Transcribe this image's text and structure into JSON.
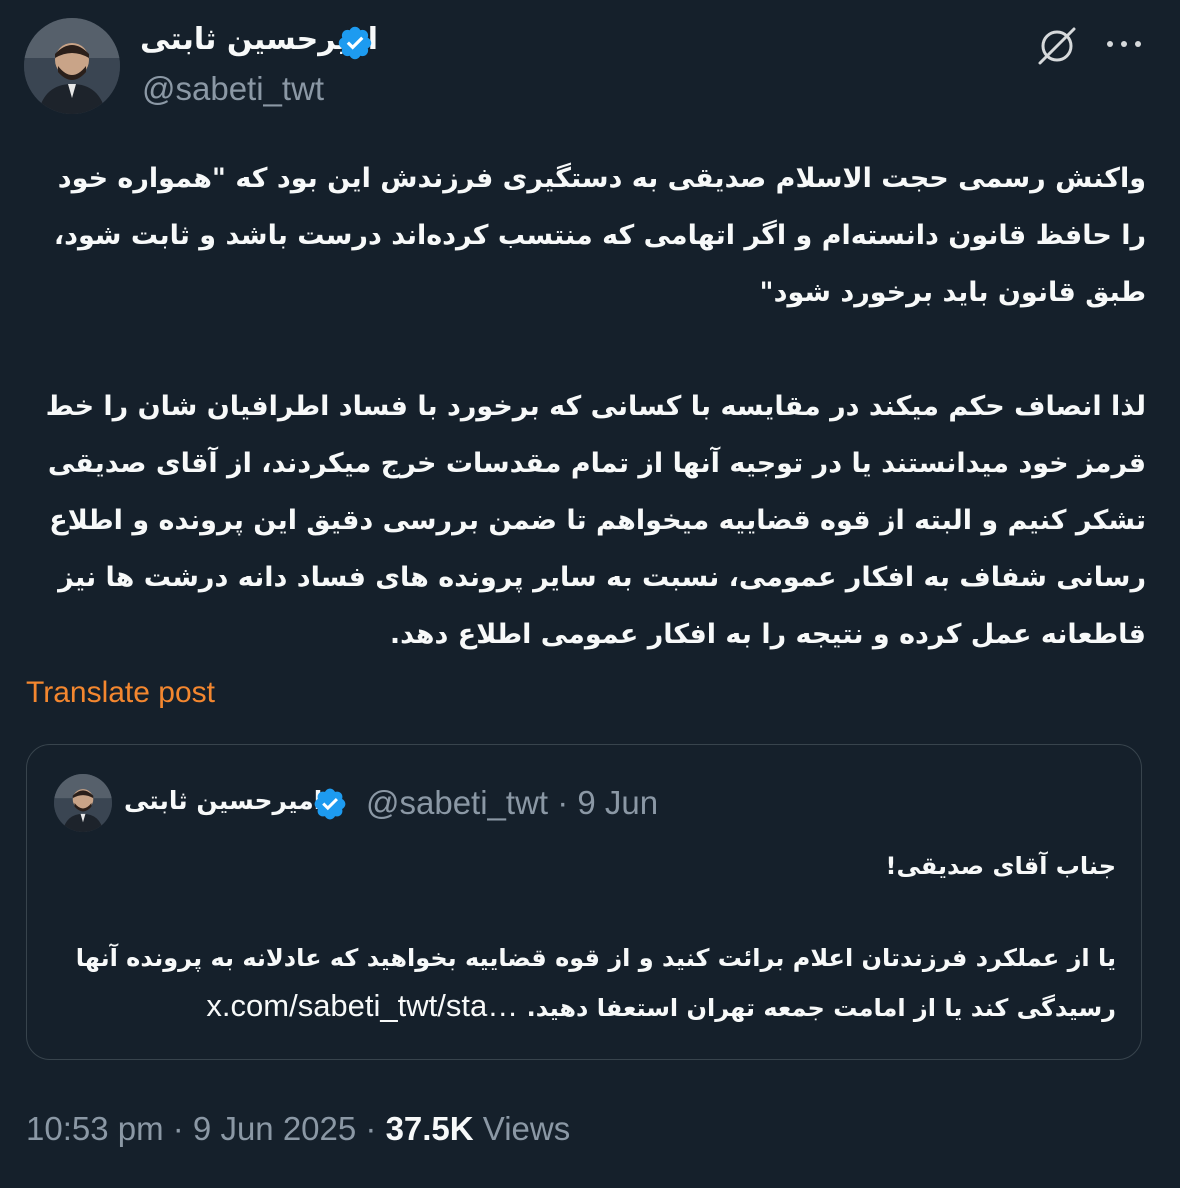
{
  "author": {
    "name": "امیرحسین ثابتی",
    "handle": "@sabeti_twt"
  },
  "post": {
    "paragraphs": [
      "واکنش رسمی حجت الاسلام صدیقی به دستگیری فرزندش این بود که \"همواره خود را حافظ قانون دانسته‌ام و اگر اتهامی که منتسب کرده‌اند درست باشد و ثابت شود، طبق قانون باید برخورد شود\"",
      "لذا انصاف حکم میکند در مقایسه با کسانی که برخورد با فساد اطرافیان شان را خط قرمز خود میدانستند یا در توجیه آنها از تمام مقدسات خرج میکردند، از آقای صدیقی تشکر کنیم و البته از قوه قضاییه میخواهم تا ضمن بررسی دقیق این پرونده و اطلاع رسانی شفاف به افکار عمومی، نسبت به سایر پرونده های فساد دانه درشت ها نیز قاطعانه عمل کرده و نتیجه را به افکار عمومی اطلاع دهد."
    ],
    "translate_label": "Translate post"
  },
  "quote": {
    "name": "امیرحسین ثابتی",
    "meta": "@sabeti_twt · 9 Jun",
    "line1": "جناب آقای صدیقی!",
    "line2": "یا از عملکرد فرزندتان اعلام برائت کنید و از قوه قضاییه بخواهید که عادلانه به پرونده آنها رسیدگی کند یا از امامت جمعه تهران استعفا دهید.",
    "link": "x.com/sabeti_twt/sta…"
  },
  "meta": {
    "time": "10:53 pm",
    "sep": " · ",
    "date": "9 Jun 2025",
    "views_count": "37.5K",
    "views_label": "Views"
  },
  "colors": {
    "background": "#15202b",
    "accent_translate": "#f4872f",
    "verified": "#1d9bf0",
    "secondary_text": "#8b98a5"
  }
}
